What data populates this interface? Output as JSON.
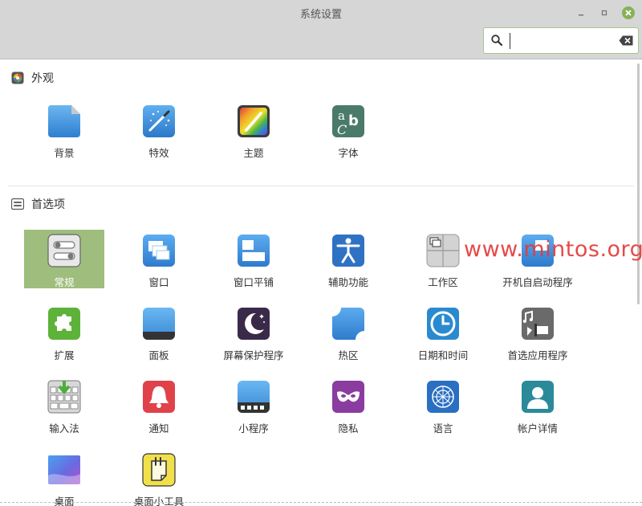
{
  "window": {
    "title": "系统设置",
    "minimize_glyph": "▫",
    "maximize_glyph": "◦",
    "close_glyph": "✕"
  },
  "search": {
    "value": "",
    "placeholder": ""
  },
  "sections": [
    {
      "title": "外观",
      "icon": "appearance-icon",
      "items": [
        {
          "label": "背景",
          "icon": "backgrounds-icon"
        },
        {
          "label": "特效",
          "icon": "effects-icon"
        },
        {
          "label": "主题",
          "icon": "themes-icon"
        },
        {
          "label": "字体",
          "icon": "fonts-icon"
        }
      ]
    },
    {
      "title": "首选项",
      "icon": "preferences-icon",
      "items": [
        {
          "label": "常规",
          "icon": "general-icon",
          "selected": true
        },
        {
          "label": "窗口",
          "icon": "windows-icon"
        },
        {
          "label": "窗口平铺",
          "icon": "window-tiling-icon"
        },
        {
          "label": "辅助功能",
          "icon": "accessibility-icon"
        },
        {
          "label": "工作区",
          "icon": "workspaces-icon"
        },
        {
          "label": "开机自启动程序",
          "icon": "startup-applications-icon"
        },
        {
          "label": "扩展",
          "icon": "extensions-icon"
        },
        {
          "label": "面板",
          "icon": "panel-icon"
        },
        {
          "label": "屏幕保护程序",
          "icon": "screensaver-icon"
        },
        {
          "label": "热区",
          "icon": "hot-corners-icon"
        },
        {
          "label": "日期和时间",
          "icon": "date-time-icon"
        },
        {
          "label": "首选应用程序",
          "icon": "preferred-applications-icon"
        },
        {
          "label": "输入法",
          "icon": "input-method-icon"
        },
        {
          "label": "通知",
          "icon": "notifications-icon"
        },
        {
          "label": "小程序",
          "icon": "applets-icon"
        },
        {
          "label": "隐私",
          "icon": "privacy-icon"
        },
        {
          "label": "语言",
          "icon": "languages-icon"
        },
        {
          "label": "帐户详情",
          "icon": "account-details-icon"
        },
        {
          "label": "桌面",
          "icon": "desktop-icon"
        },
        {
          "label": "桌面小工具",
          "icon": "desklets-icon"
        }
      ]
    }
  ],
  "watermark": "www.mintos.org",
  "colors": {
    "selected": "#9fbd7d",
    "close_button": "#87b158",
    "watermark": "#e43a3a"
  }
}
